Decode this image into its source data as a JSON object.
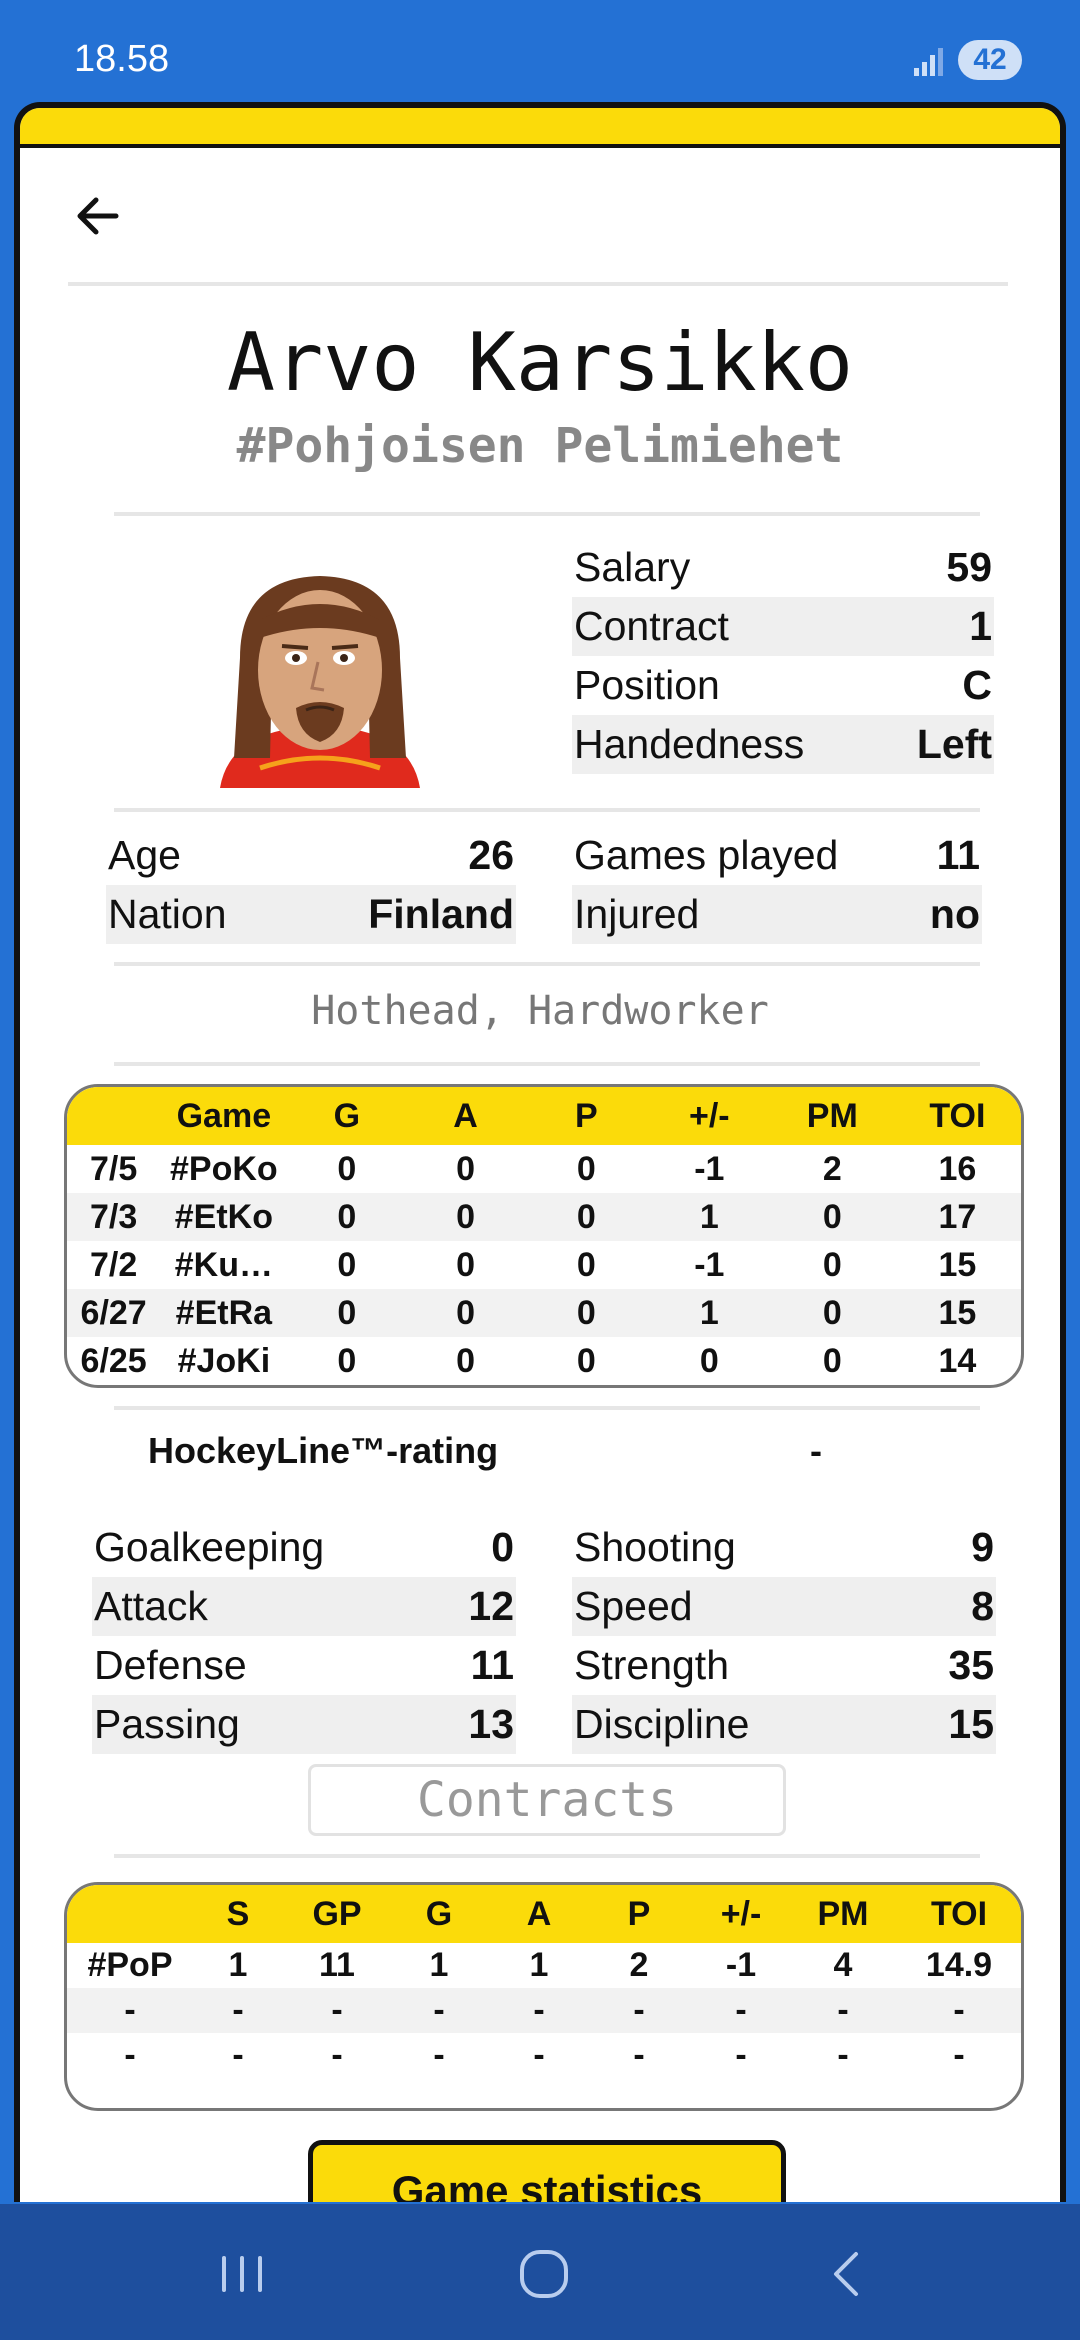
{
  "status": {
    "time": "18.58",
    "battery": "42"
  },
  "player": {
    "name": "Arvo Karsikko",
    "team": "#Pohjoisen Pelimiehet",
    "traits": "Hothead, Hardworker"
  },
  "info_right": [
    {
      "label": "Salary",
      "value": "59"
    },
    {
      "label": "Contract",
      "value": "1"
    },
    {
      "label": "Position",
      "value": "C"
    },
    {
      "label": "Handedness",
      "value": "Left"
    }
  ],
  "info_left2": [
    {
      "label": "Age",
      "value": "26"
    },
    {
      "label": "Nation",
      "value": "Finland"
    }
  ],
  "info_right2": [
    {
      "label": "Games played",
      "value": "11"
    },
    {
      "label": "Injured",
      "value": "no"
    }
  ],
  "games_table": {
    "headers": [
      "",
      "Game",
      "G",
      "A",
      "P",
      "+/-",
      "PM",
      "TOI"
    ],
    "rows": [
      [
        "7/5",
        "#PoKo",
        "0",
        "0",
        "0",
        "-1",
        "2",
        "16"
      ],
      [
        "7/3",
        "#EtKo",
        "0",
        "0",
        "0",
        "1",
        "0",
        "17"
      ],
      [
        "7/2",
        "#Ku…",
        "0",
        "0",
        "0",
        "-1",
        "0",
        "15"
      ],
      [
        "6/27",
        "#EtRa",
        "0",
        "0",
        "0",
        "1",
        "0",
        "15"
      ],
      [
        "6/25",
        "#JoKi",
        "0",
        "0",
        "0",
        "0",
        "0",
        "14"
      ]
    ]
  },
  "rating": {
    "label": "HockeyLine™-rating",
    "value": "-"
  },
  "skills_left": [
    {
      "label": "Goalkeeping",
      "value": "0"
    },
    {
      "label": "Attack",
      "value": "12"
    },
    {
      "label": "Defense",
      "value": "11"
    },
    {
      "label": "Passing",
      "value": "13"
    }
  ],
  "skills_right": [
    {
      "label": "Shooting",
      "value": "9"
    },
    {
      "label": "Speed",
      "value": "8"
    },
    {
      "label": "Strength",
      "value": "35"
    },
    {
      "label": "Discipline",
      "value": "15"
    }
  ],
  "contracts_button": "Contracts",
  "season_table": {
    "headers": [
      "",
      "S",
      "GP",
      "G",
      "A",
      "P",
      "+/-",
      "PM",
      "TOI"
    ],
    "rows": [
      [
        "#PoP",
        "1",
        "11",
        "1",
        "1",
        "2",
        "-1",
        "4",
        "14.9"
      ],
      [
        "-",
        "-",
        "-",
        "-",
        "-",
        "-",
        "-",
        "-",
        "-"
      ],
      [
        "-",
        "-",
        "-",
        "-",
        "-",
        "-",
        "-",
        "-",
        "-"
      ]
    ]
  },
  "game_stats_button": "Game statistics",
  "colors": {
    "accent": "#fbdb0a",
    "status_bar": "#2471d4",
    "nav_bar": "#1e4f9e"
  },
  "nav": {
    "icons": [
      "recent-apps-icon",
      "home-icon",
      "back-nav-icon"
    ]
  }
}
